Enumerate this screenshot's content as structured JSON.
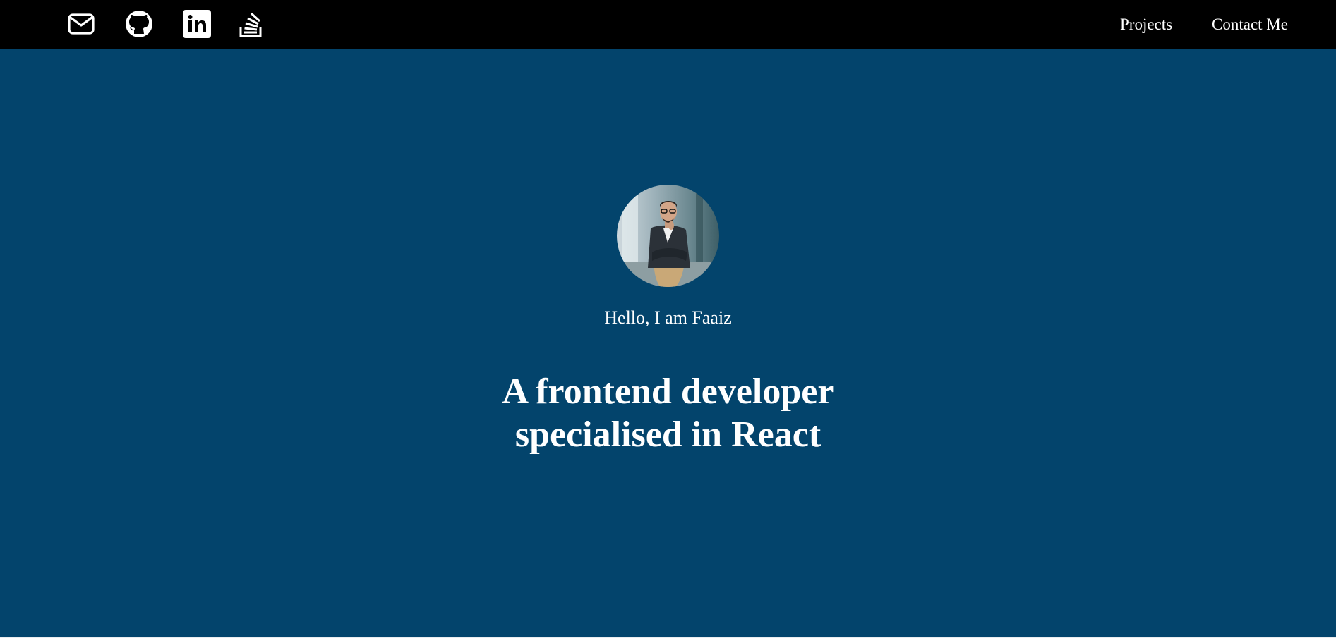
{
  "navbar": {
    "icons": [
      {
        "name": "mail-icon"
      },
      {
        "name": "github-icon"
      },
      {
        "name": "linkedin-icon"
      },
      {
        "name": "stackoverflow-icon"
      }
    ],
    "links": {
      "projects": "Projects",
      "contact": "Contact Me"
    }
  },
  "hero": {
    "greeting": "Hello, I am Faaiz",
    "headline_line1": "A frontend developer",
    "headline_line2": "specialised in React"
  },
  "colors": {
    "navbar_bg": "#000000",
    "hero_bg": "#03446c",
    "text": "#ffffff"
  }
}
